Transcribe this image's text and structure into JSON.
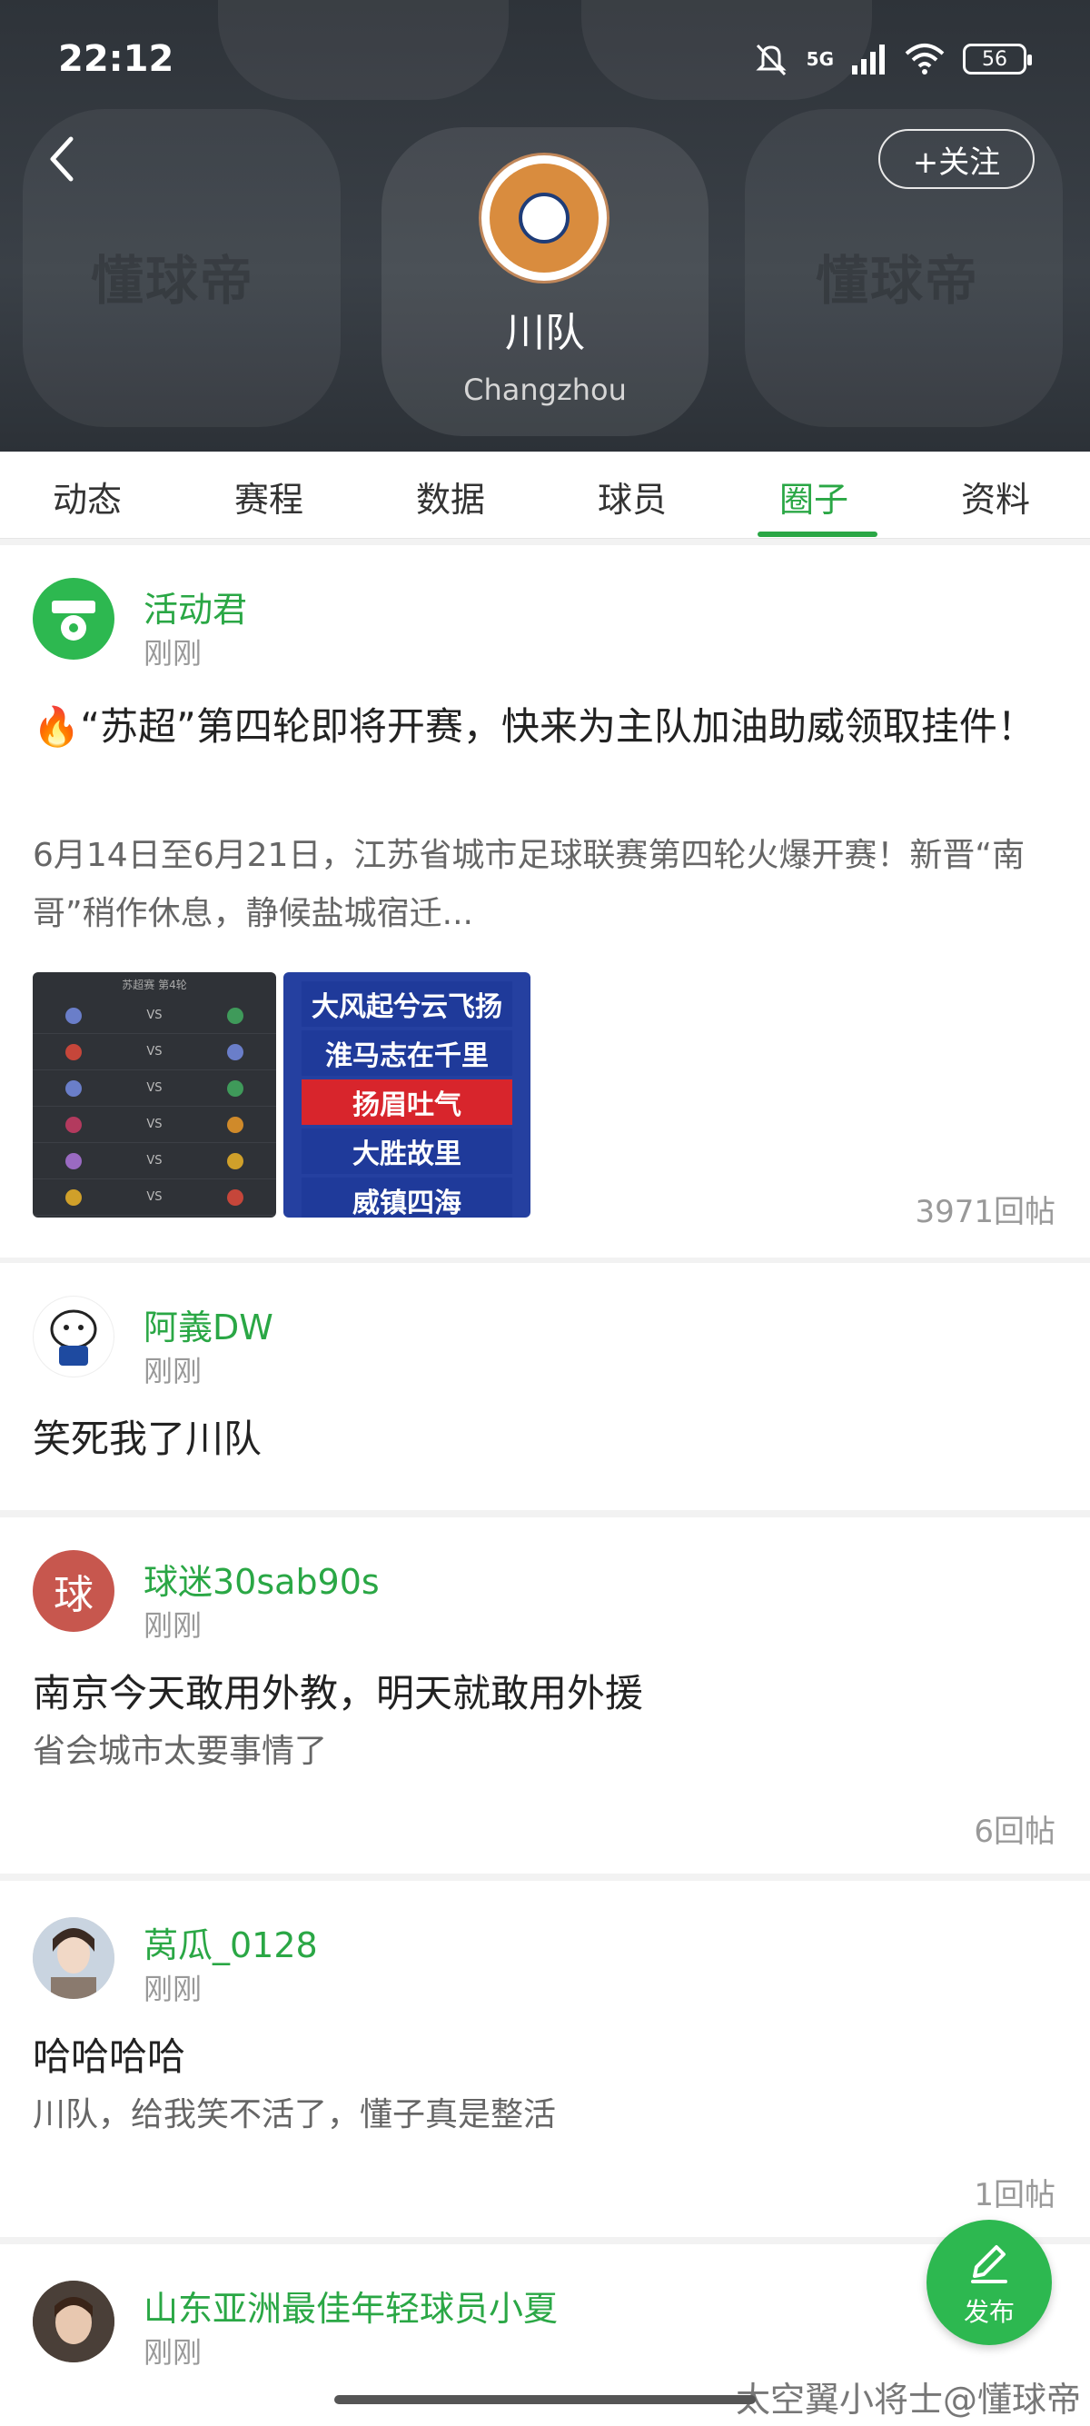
{
  "status_bar": {
    "time": "22:12",
    "network": "5G",
    "battery": "56"
  },
  "header": {
    "follow_label": "+关注",
    "team_name": "川队",
    "team_subname": "Changzhou",
    "watermark": "懂球帝"
  },
  "tabs": [
    {
      "label": "动态",
      "active": false
    },
    {
      "label": "赛程",
      "active": false
    },
    {
      "label": "数据",
      "active": false
    },
    {
      "label": "球员",
      "active": false
    },
    {
      "label": "圈子",
      "active": true
    },
    {
      "label": "资料",
      "active": false
    }
  ],
  "posts": [
    {
      "username": "活动君",
      "time": "刚刚",
      "title": "🔥“苏超”第四轮即将开赛，快来为主队加油助威领取挂件！",
      "body": "6月14日至6月21日，江苏省城市足球联赛第四轮火爆开赛！新晋“南哥”稍作休息，静候盐城宿迁...",
      "replies": "3971回帖",
      "images": {
        "fixture_title": "苏超赛 第4轮",
        "banner_lines": [
          "大风起兮云飞扬",
          "淮马志在千里",
          "扬眉吐气",
          "大胜故里",
          "威镇四海"
        ]
      }
    },
    {
      "username": "阿義DW",
      "time": "刚刚",
      "title": "笑死我了川队",
      "body": "",
      "replies": ""
    },
    {
      "username": "球迷30sab90s",
      "time": "刚刚",
      "avatar_char": "球",
      "title": "南京今天敢用外教，明天就敢用外援",
      "body": "省会城市太要事情了",
      "replies": "6回帖"
    },
    {
      "username": "莴瓜_0128",
      "time": "刚刚",
      "title": "哈哈哈哈",
      "body": "川队，给我笑不活了，懂子真是整活",
      "replies": "1回帖"
    },
    {
      "username": "山东亚洲最佳年轻球员小夏",
      "time": "刚刚"
    }
  ],
  "publish_label": "发布",
  "credit": "太空翼小将士@懂球帝",
  "colors": {
    "accent": "#2aa745",
    "header_bg": "#353a40"
  }
}
